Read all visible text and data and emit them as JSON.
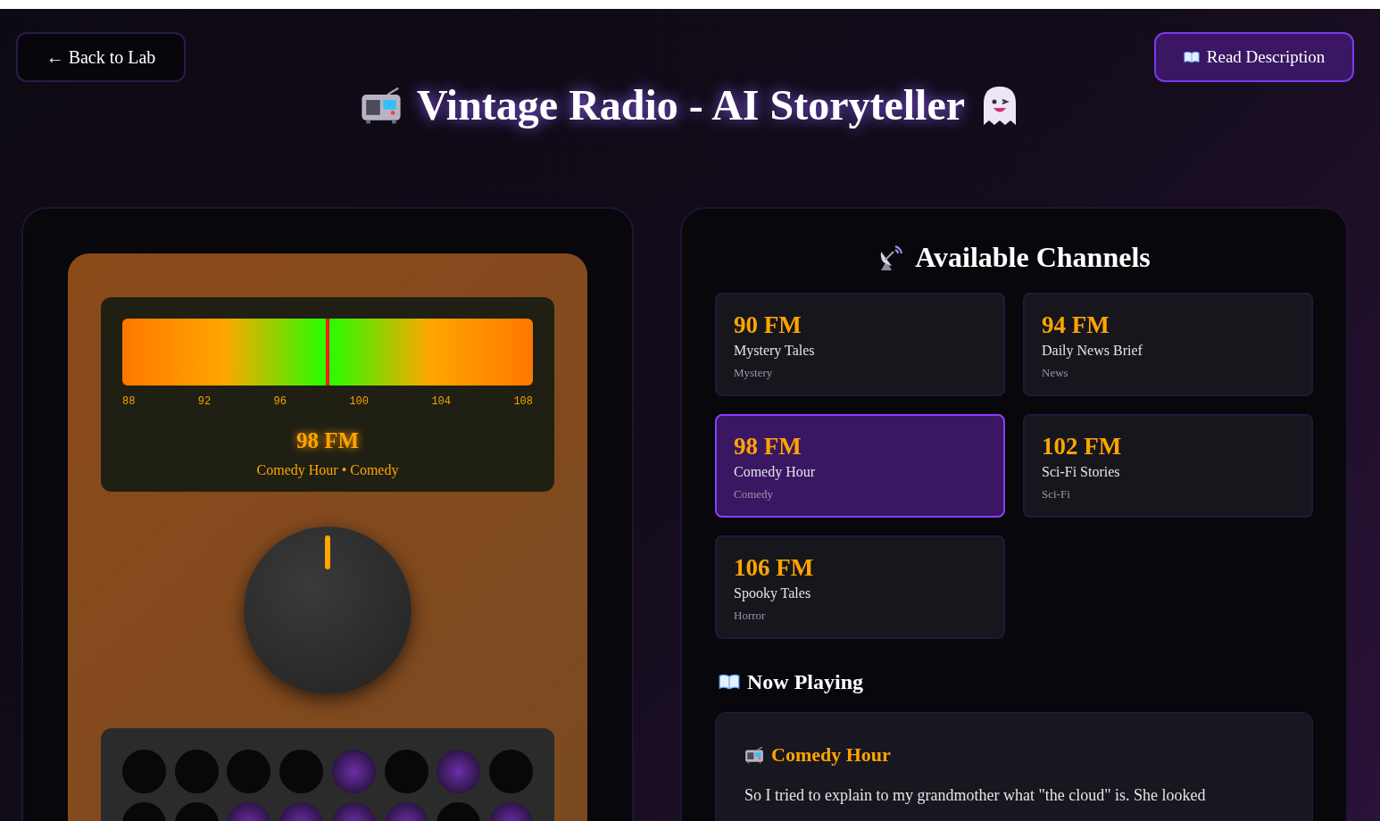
{
  "header": {
    "back_button": "← Back to Lab",
    "description_button": "Read Description",
    "title": "Vintage Radio - AI Storyteller"
  },
  "radio": {
    "dial": {
      "level": 0.5,
      "ticks": [
        "88",
        "92",
        "96",
        "100",
        "104",
        "108"
      ]
    },
    "frequency": "98 FM",
    "station_line": "Comedy Hour • Comedy",
    "speaker_rows": [
      [
        {
          "on": false
        },
        {
          "on": false
        },
        {
          "on": false
        },
        {
          "on": false
        },
        {
          "on": true
        },
        {
          "on": false
        },
        {
          "on": true
        },
        {
          "on": false
        }
      ],
      [
        {
          "on": false
        },
        {
          "on": false
        },
        {
          "on": true
        },
        {
          "on": true
        },
        {
          "on": true
        },
        {
          "on": true
        },
        {
          "on": false
        },
        {
          "on": true
        }
      ]
    ]
  },
  "channels": {
    "title": "Available Channels",
    "items": [
      {
        "frequency": "90 FM",
        "name": "Mystery Tales",
        "genre": "Mystery",
        "selected": false
      },
      {
        "frequency": "94 FM",
        "name": "Daily News Brief",
        "genre": "News",
        "selected": false
      },
      {
        "frequency": "98 FM",
        "name": "Comedy Hour",
        "genre": "Comedy",
        "selected": true
      },
      {
        "frequency": "102 FM",
        "name": "Sci-Fi Stories",
        "genre": "Sci-Fi",
        "selected": false
      },
      {
        "frequency": "106 FM",
        "name": "Spooky Tales",
        "genre": "Horror",
        "selected": false
      }
    ]
  },
  "now_playing": {
    "title": "Now Playing",
    "story_title": "Comedy Hour",
    "story_text": "So I tried to explain to my grandmother what \"the cloud\" is. She looked"
  }
}
